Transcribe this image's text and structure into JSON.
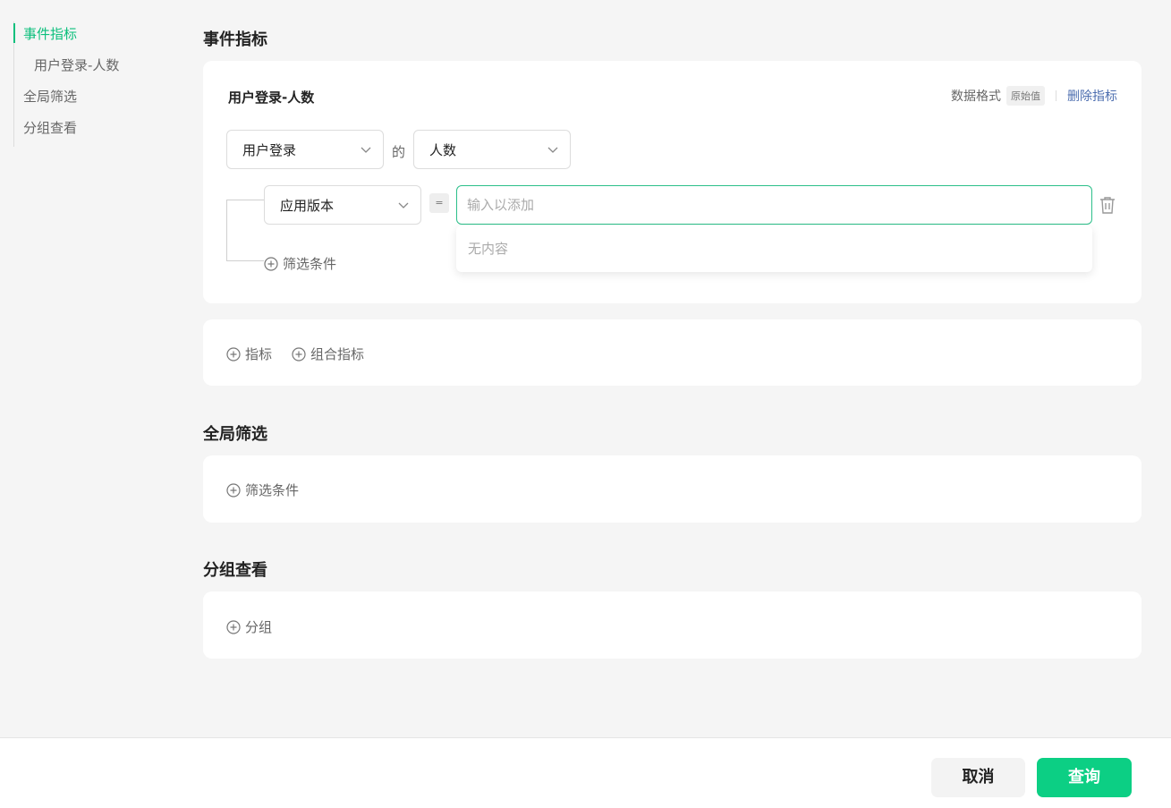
{
  "sidebar": {
    "items": [
      {
        "label": "事件指标"
      },
      {
        "label": "用户登录-人数"
      },
      {
        "label": "全局筛选"
      },
      {
        "label": "分组查看"
      }
    ]
  },
  "event_metrics": {
    "title": "事件指标",
    "metric": {
      "name": "用户登录-人数",
      "data_format_label": "数据格式",
      "data_format_value": "原始值",
      "delete_label": "删除指标",
      "event_select": "用户登录",
      "of_text": "的",
      "measure_select": "人数",
      "filter": {
        "property_select": "应用版本",
        "operator": "=",
        "value_placeholder": "输入以添加",
        "dropdown_empty": "无内容"
      },
      "add_filter_label": "筛选条件"
    },
    "add_metric_label": "指标",
    "add_combo_metric_label": "组合指标"
  },
  "global_filter": {
    "title": "全局筛选",
    "add_filter_label": "筛选条件"
  },
  "group_by": {
    "title": "分组查看",
    "add_group_label": "分组"
  },
  "footer": {
    "cancel_label": "取消",
    "query_label": "查询"
  },
  "colors": {
    "accent": "#0bbf7c",
    "primary_button": "#0ccf84",
    "link": "#4e6fb0",
    "input_focus_border": "#2cbf8a"
  },
  "icons": [
    "chevron-down-icon",
    "plus-circle-icon",
    "trash-icon"
  ]
}
